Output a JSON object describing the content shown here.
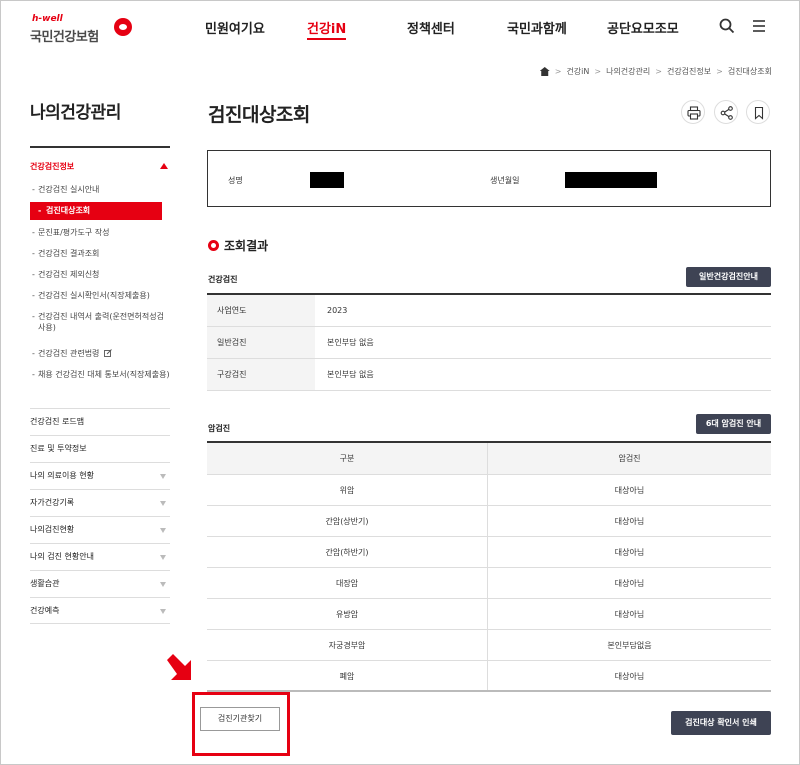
{
  "header": {
    "logo_tag": "h-well",
    "logo_name": "국민건강보험",
    "nav": [
      "민원여기요",
      "건강iN",
      "정책센터",
      "국민과함께",
      "공단요모조모"
    ],
    "active_nav": "건강iN"
  },
  "breadcrumb": [
    "건강iN",
    "나의건강관리",
    "건강검진정보",
    "검진대상조회"
  ],
  "sidebar": {
    "title": "나의건강관리",
    "active_group": "건강검진정보",
    "sub_items": [
      "건강검진 실시안내",
      "검진대상조회",
      "문진표/평가도구 작성",
      "건강검진 결과조회",
      "건강검진 제외신청",
      "건강검진 실시확인서(직장제출용)",
      "건강검진 내역서 출력(운전면허적성검사용)",
      "건강검진 관련법령",
      "채용 건강검진 대체 통보서(직장제출용)"
    ],
    "menus": [
      "건강검진 로드맵",
      "진료 및 투약정보",
      "나의 의료이용 현황",
      "자가건강기록",
      "나의검진현황",
      "나의 검진 현황안내",
      "생활습관",
      "건강예측"
    ]
  },
  "main": {
    "title": "검진대상조회",
    "name_label": "성명",
    "birth_label": "생년월일",
    "result_title": "조회결과",
    "checkup_label": "건강검진",
    "checkup_btn": "일반건강검진안내",
    "checkup_rows": [
      {
        "k": "사업연도",
        "v": "2023"
      },
      {
        "k": "일반검진",
        "v": "본인부담 없음"
      },
      {
        "k": "구강검진",
        "v": "본인부담 없음"
      }
    ],
    "cancer_label": "암검진",
    "cancer_btn": "6대 암검진 안내",
    "cancer_headers": [
      "구분",
      "암검진"
    ],
    "cancer_rows": [
      {
        "k": "위암",
        "v": "대상아님"
      },
      {
        "k": "간암(상반기)",
        "v": "대상아님"
      },
      {
        "k": "간암(하반기)",
        "v": "대상아님"
      },
      {
        "k": "대장암",
        "v": "대상아님"
      },
      {
        "k": "유방암",
        "v": "대상아님"
      },
      {
        "k": "자궁경부암",
        "v": "본인부담없음"
      },
      {
        "k": "폐암",
        "v": "대상아님"
      }
    ],
    "find_btn": "검진기관찾기",
    "print_btn": "검진대상 확인서 인쇄"
  },
  "colors": {
    "accent": "#e60012",
    "dark_button": "#3e4354"
  }
}
